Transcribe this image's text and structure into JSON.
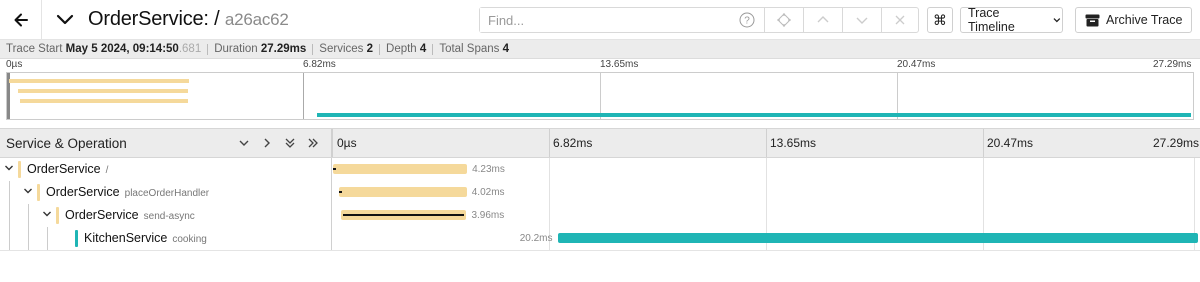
{
  "header": {
    "back_icon": "arrow-left-icon",
    "collapse_icon": "chevron-down-icon",
    "service_title": "OrderService: /",
    "trace_id": "a26ac62",
    "find_placeholder": "Find...",
    "timeline_select_label": "Trace Timeline",
    "archive_label": "Archive Trace",
    "colors": {
      "border": "#d0d0d0",
      "text": "#222222"
    }
  },
  "meta": {
    "trace_start_label": "Trace Start",
    "trace_start_value": "May 5 2024, 09:14:50",
    "trace_start_ms": ".681",
    "duration_label": "Duration",
    "duration_value": "27.29ms",
    "services_label": "Services",
    "services_value": "2",
    "depth_label": "Depth",
    "depth_value": "4",
    "total_spans_label": "Total Spans",
    "total_spans_value": "4"
  },
  "minimap": {
    "ticks": [
      "0µs",
      "6.82ms",
      "13.65ms",
      "20.47ms",
      "27.29ms"
    ]
  },
  "table": {
    "column_title": "Service & Operation",
    "ticks": [
      "0µs",
      "6.82ms",
      "13.65ms",
      "20.47ms",
      "27.29ms"
    ]
  },
  "spans": [
    {
      "service": "OrderService",
      "operation": "/",
      "depth": 0,
      "start_ms": 0,
      "duration_ms": 4.23,
      "duration_label": "4.23ms",
      "color": "#f5d99b"
    },
    {
      "service": "OrderService",
      "operation": "placeOrderHandler",
      "depth": 1,
      "start_ms": 0.2,
      "duration_ms": 4.02,
      "duration_label": "4.02ms",
      "color": "#f5d99b"
    },
    {
      "service": "OrderService",
      "operation": "send-async",
      "depth": 2,
      "start_ms": 0.25,
      "duration_ms": 3.96,
      "duration_label": "3.96ms",
      "color": "#f5d99b"
    },
    {
      "service": "KitchenService",
      "operation": "cooking",
      "depth": 3,
      "start_ms": 7.09,
      "duration_ms": 20.2,
      "duration_label": "20.2ms",
      "color": "#1fb5b5"
    }
  ]
}
